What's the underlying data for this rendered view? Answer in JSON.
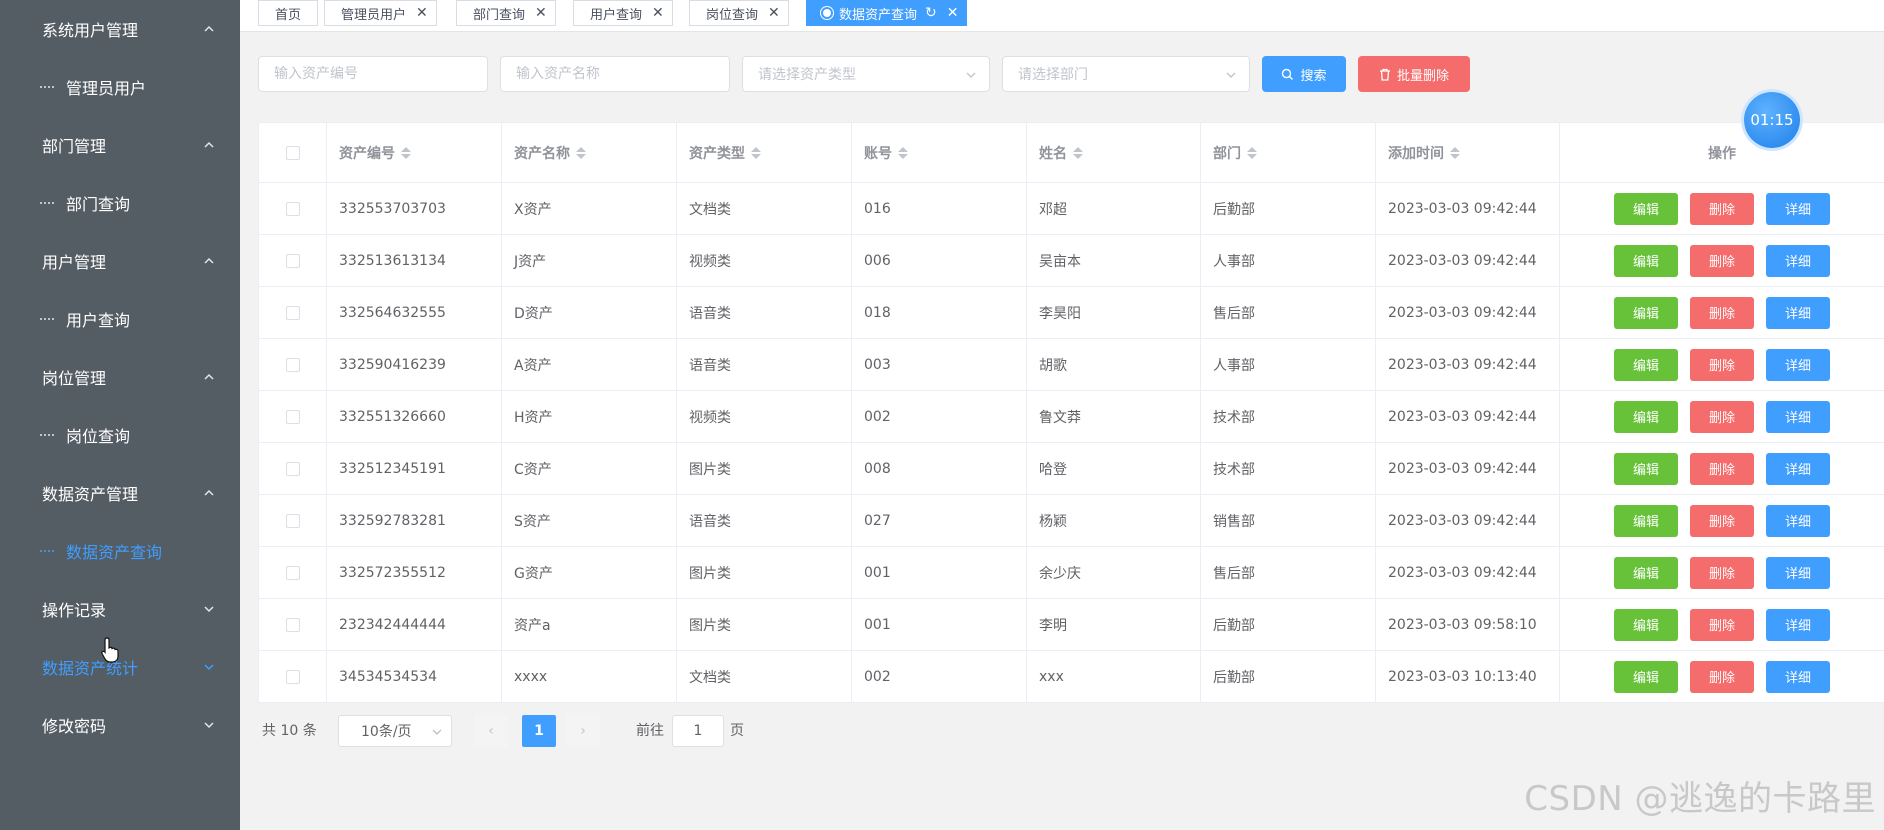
{
  "sidebar": {
    "groups": [
      {
        "label": "系统用户管理",
        "expanded": true,
        "children": [
          {
            "label": "管理员用户",
            "active": false
          }
        ]
      },
      {
        "label": "部门管理",
        "expanded": true,
        "children": [
          {
            "label": "部门查询",
            "active": false
          }
        ]
      },
      {
        "label": "用户管理",
        "expanded": true,
        "children": [
          {
            "label": "用户查询",
            "active": false
          }
        ]
      },
      {
        "label": "岗位管理",
        "expanded": true,
        "children": [
          {
            "label": "岗位查询",
            "active": false
          }
        ]
      },
      {
        "label": "数据资产管理",
        "expanded": true,
        "children": [
          {
            "label": "数据资产查询",
            "active": true
          }
        ]
      },
      {
        "label": "操作记录",
        "expanded": false,
        "children": []
      },
      {
        "label": "数据资产统计",
        "expanded": false,
        "active": true,
        "children": []
      },
      {
        "label": "修改密码",
        "expanded": false,
        "children": []
      }
    ]
  },
  "tabs": [
    {
      "label": "首页",
      "closable": false,
      "active": false
    },
    {
      "label": "管理员用户",
      "closable": true,
      "active": false
    },
    {
      "label": "部门查询",
      "closable": true,
      "active": false
    },
    {
      "label": "用户查询",
      "closable": true,
      "active": false
    },
    {
      "label": "岗位查询",
      "closable": true,
      "active": false
    },
    {
      "label": "数据资产查询",
      "closable": true,
      "active": true
    }
  ],
  "search": {
    "asset_no_placeholder": "输入资产编号",
    "asset_name_placeholder": "输入资产名称",
    "asset_type_placeholder": "请选择资产类型",
    "dept_placeholder": "请选择部门",
    "search_label": "搜索",
    "batch_delete_label": "批量删除"
  },
  "timer": "01:15",
  "table": {
    "columns": [
      "资产编号",
      "资产名称",
      "资产类型",
      "账号",
      "姓名",
      "部门",
      "添加时间",
      "操作"
    ],
    "actions": {
      "edit": "编辑",
      "delete": "删除",
      "detail": "详细"
    },
    "rows": [
      {
        "asset_no": "332553703703",
        "asset_name": "X资产",
        "asset_type": "文档类",
        "account": "016",
        "name": "邓超",
        "dept": "后勤部",
        "added": "2023-03-03 09:42:44"
      },
      {
        "asset_no": "332513613134",
        "asset_name": "J资产",
        "asset_type": "视频类",
        "account": "006",
        "name": "吴亩本",
        "dept": "人事部",
        "added": "2023-03-03 09:42:44"
      },
      {
        "asset_no": "332564632555",
        "asset_name": "D资产",
        "asset_type": "语音类",
        "account": "018",
        "name": "李昊阳",
        "dept": "售后部",
        "added": "2023-03-03 09:42:44"
      },
      {
        "asset_no": "332590416239",
        "asset_name": "A资产",
        "asset_type": "语音类",
        "account": "003",
        "name": "胡歌",
        "dept": "人事部",
        "added": "2023-03-03 09:42:44"
      },
      {
        "asset_no": "332551326660",
        "asset_name": "H资产",
        "asset_type": "视频类",
        "account": "002",
        "name": "鲁文莽",
        "dept": "技术部",
        "added": "2023-03-03 09:42:44"
      },
      {
        "asset_no": "332512345191",
        "asset_name": "C资产",
        "asset_type": "图片类",
        "account": "008",
        "name": "哈登",
        "dept": "技术部",
        "added": "2023-03-03 09:42:44"
      },
      {
        "asset_no": "332592783281",
        "asset_name": "S资产",
        "asset_type": "语音类",
        "account": "027",
        "name": "杨颖",
        "dept": "销售部",
        "added": "2023-03-03 09:42:44"
      },
      {
        "asset_no": "332572355512",
        "asset_name": "G资产",
        "asset_type": "图片类",
        "account": "001",
        "name": "余少庆",
        "dept": "售后部",
        "added": "2023-03-03 09:42:44"
      },
      {
        "asset_no": "232342444444",
        "asset_name": "资产a",
        "asset_type": "图片类",
        "account": "001",
        "name": "李明",
        "dept": "后勤部",
        "added": "2023-03-03 09:58:10"
      },
      {
        "asset_no": "34534534534",
        "asset_name": "xxxx",
        "asset_type": "文档类",
        "account": "002",
        "name": "xxx",
        "dept": "后勤部",
        "added": "2023-03-03 10:13:40"
      }
    ]
  },
  "pagination": {
    "total_text": "共 10 条",
    "page_size": "10条/页",
    "current_page": "1",
    "goto_prefix": "前往",
    "goto_value": "1",
    "goto_suffix": "页"
  },
  "watermark": "CSDN @逃逸的卡路里",
  "colors": {
    "sidebar_bg": "#545c64",
    "primary": "#409eff",
    "danger": "#f56c6c",
    "success": "#67c23a"
  }
}
